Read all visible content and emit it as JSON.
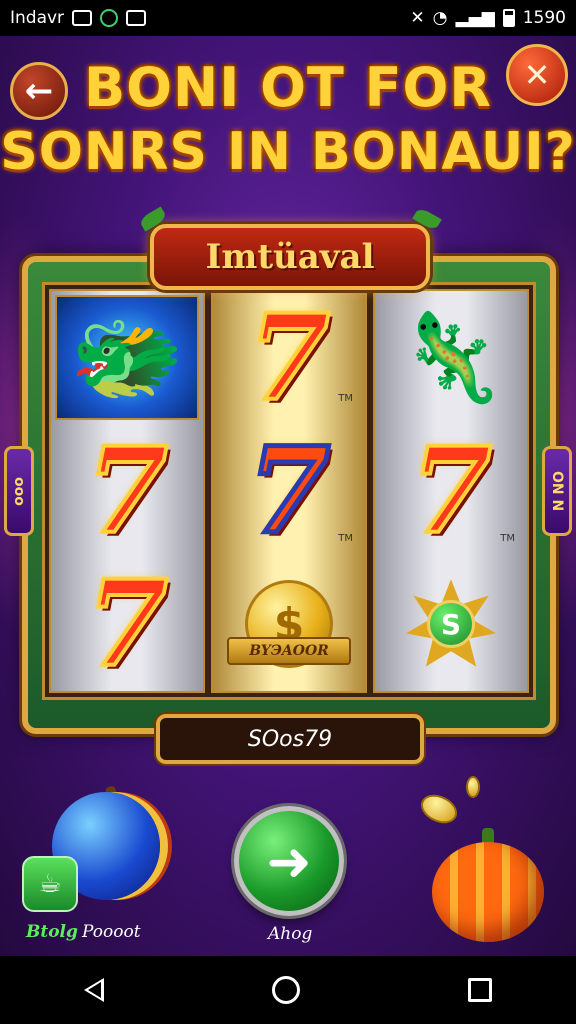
{
  "status_bar": {
    "carrier": "Indavr",
    "time": "1590"
  },
  "header": {
    "title_line1": "BONI OT FOR",
    "title_line2": "SONRS IN BONAUI?",
    "back_icon": "arrow-left-icon",
    "close_icon": "close-x-icon"
  },
  "machine": {
    "banner": "Imtüaval",
    "reels": [
      [
        "dragon-wild",
        "seven",
        "seven"
      ],
      [
        "seven",
        "seven-blue",
        "gold-coin"
      ],
      [
        "character",
        "seven",
        "dollar-badge"
      ]
    ],
    "tm_label": "TM",
    "coin_ribbon": "BYЭAOOR",
    "dollar_symbol": "S",
    "score": "SOos79",
    "side_left": "ooo",
    "side_right": "ON N"
  },
  "bottom": {
    "left_label_1": "Btolg",
    "left_label_2": "Poooot",
    "center_label": "Ahog",
    "play_icon": "arrow-right-icon"
  },
  "colors": {
    "title": "#ffd23a",
    "frame_gold": "#e0a842",
    "play_green": "#1a9a2a",
    "background": "#431478"
  }
}
